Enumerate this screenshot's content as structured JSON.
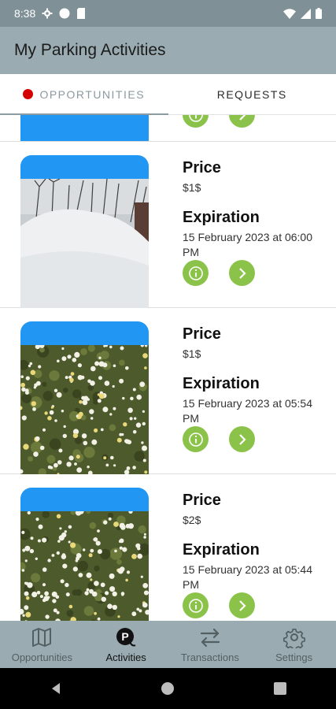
{
  "status_bar": {
    "time": "8:38"
  },
  "app_bar": {
    "title": "My Parking Activities"
  },
  "tabs": [
    {
      "label": "OPPORTUNITIES",
      "active": true,
      "indicator_color": "#d40000"
    },
    {
      "label": "REQUESTS",
      "active": false
    }
  ],
  "cards": [
    {
      "price_label": "Price",
      "price": "$1$",
      "expiration_label": "Expiration",
      "expiration": "15 February 2023 at 06:00 PM",
      "image": "snow pile"
    },
    {
      "price_label": "Price",
      "price": "$1$",
      "expiration_label": "Expiration",
      "expiration": "15 February 2023 at 05:54 PM",
      "image": "daisy field"
    },
    {
      "price_label": "Price",
      "price": "$2$",
      "expiration_label": "Expiration",
      "expiration": "15 February 2023 at 05:44 PM",
      "image": "daisy field"
    }
  ],
  "bottom_nav": [
    {
      "label": "Opportunities",
      "icon": "map-icon",
      "active": false
    },
    {
      "label": "Activities",
      "icon": "parking-icon",
      "active": true
    },
    {
      "label": "Transactions",
      "icon": "swap-icon",
      "active": false
    },
    {
      "label": "Settings",
      "icon": "gear-icon",
      "active": false
    }
  ],
  "colors": {
    "accent": "#8bc34a",
    "header": "#9aacb2",
    "status_bar": "#7f9197",
    "image_header": "#2196f3"
  }
}
